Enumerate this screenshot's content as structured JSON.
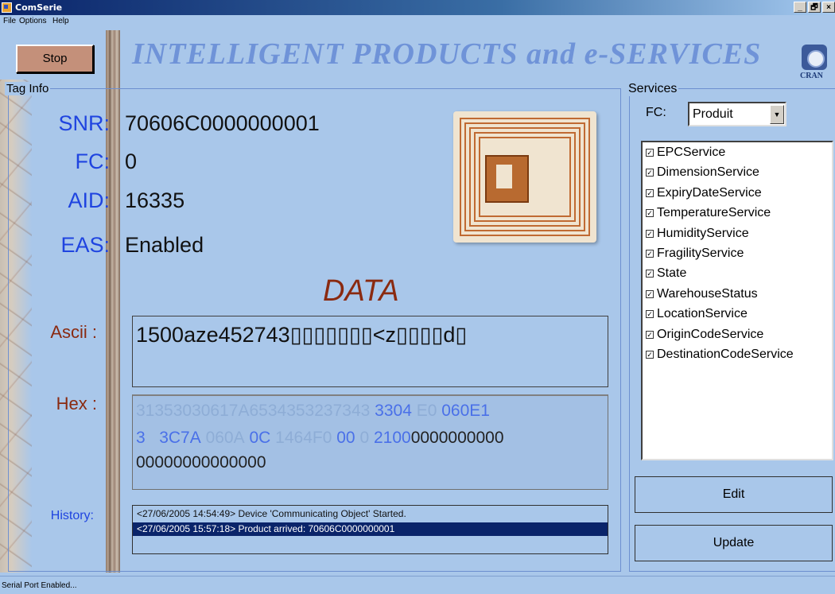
{
  "window": {
    "title": "ComSerie",
    "controls": [
      "_",
      "🗗",
      "×"
    ]
  },
  "menu": [
    "File",
    "Options",
    "Help"
  ],
  "stop_button": "Stop",
  "banner": "INTELLIGENT PRODUCTS  and  e-SERVICES",
  "logo_text": "CRAN",
  "tag_info": {
    "group_label": "Tag  Info",
    "snr_label": "SNR:",
    "snr": "70606C0000000001",
    "fc_label": "FC:",
    "fc": "0",
    "aid_label": "AID:",
    "aid": "16335",
    "eas_label": "EAS:",
    "eas": "Enabled"
  },
  "data": {
    "title": "DATA",
    "ascii_label": "Ascii :",
    "ascii_value": "1500aze452743▯▯▯▯▯▯▯<z▯▯▯▯d▯",
    "hex_label": "Hex :",
    "hex_line1_faded": "31353030617A6534353237343",
    "hex_line1_blue": "3304",
    "hex_line1_faded2": "E0",
    "hex_line1_end": "060E1",
    "hex_line2_start": "3",
    "hex_line2_a": "3C7A",
    "hex_line2_faded": "060A",
    "hex_line2_b": "0C",
    "hex_line2_faded2": "1464F0",
    "hex_line2_c": "00",
    "hex_line2_faded3": "0",
    "hex_line2_d": "2100",
    "hex_line2_dark": "0000000000",
    "hex_line3": "00000000000000"
  },
  "history": {
    "label": "History:",
    "rows": [
      "<27/06/2005 14:54:49> Device 'Communicating Object' Started.",
      "<27/06/2005 15:57:18> Product arrived: 70606C0000000001"
    ]
  },
  "services": {
    "group_label": "Services",
    "fc_label": "FC:",
    "fc_selected": "Produit",
    "items": [
      "EPCService",
      "DimensionService",
      "ExpiryDateService",
      "TemperatureService",
      "HumidityService",
      "FragilityService",
      "State",
      "WarehouseStatus",
      "LocationService",
      "OriginCodeService",
      "DestinationCodeService"
    ],
    "edit_button": "Edit",
    "update_button": "Update"
  },
  "status": "Serial Port Enabled..."
}
